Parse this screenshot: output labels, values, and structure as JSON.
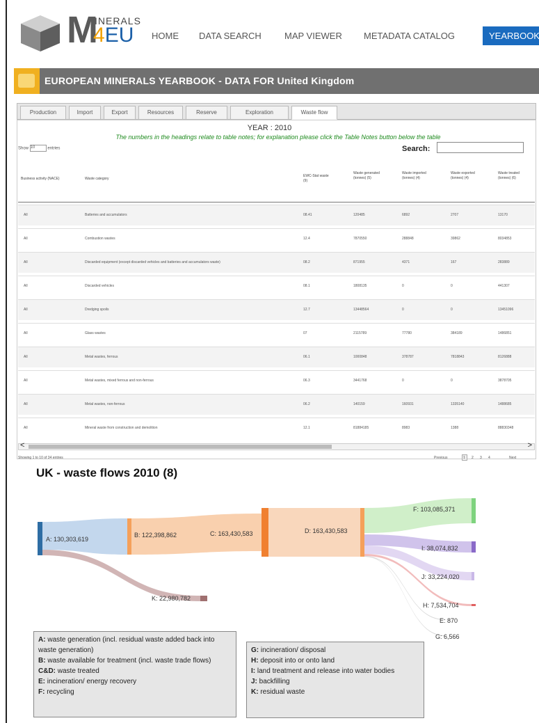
{
  "header": {
    "logo_m": "M",
    "logo_inerals": "INERALS",
    "logo_4": "4",
    "logo_eu": "EU",
    "nav": [
      "HOME",
      "DATA SEARCH",
      "MAP VIEWER",
      "METADATA CATALOG"
    ],
    "nav_active": "YEARBOOK",
    "accent": "#1a6bbf"
  },
  "titlebar": {
    "title": "EUROPEAN MINERALS YEARBOOK - DATA FOR  United Kingdom"
  },
  "tabs": [
    {
      "label": "Production"
    },
    {
      "label": "Import"
    },
    {
      "label": "Export"
    },
    {
      "label": "Resources"
    },
    {
      "label": "Reserve"
    },
    {
      "label": "Exploration"
    },
    {
      "label": "Waste flow"
    }
  ],
  "table_meta": {
    "year": "YEAR : 2010",
    "note": "The numbers in the headings relate to table notes; for explanation please click the Table Notes button below the table",
    "show_prefix": "Show",
    "show_value": "10",
    "show_suffix": "entries",
    "search_label": "Search:",
    "info": "Showing 1 to 10 of 34 entries",
    "prev": "Previous",
    "next": "Next",
    "pages": [
      "1",
      "2",
      "3",
      "4"
    ]
  },
  "table": {
    "headers": [
      "Business activity (NACE)",
      "Waste category",
      "EWC-Stat waste (9)",
      "Waste generated (tonnes) (5)",
      "Waste imported (tonnes) (4)",
      "Waste exported (tonnes) (4)",
      "Waste treated (tonnes) (6)"
    ],
    "rows": [
      [
        "All",
        "Batteries and accumulators",
        "08.41",
        "120485",
        "6892",
        "2707",
        "13170"
      ],
      [
        "All",
        "Combustion wastes",
        "12.4",
        "7870550",
        "288848",
        "39862",
        "8034853"
      ],
      [
        "All",
        "Discarded equipment (except discarded vehicles and batteries and accumulators waste)",
        "08.2",
        "871955",
        "4371",
        "167",
        "283889"
      ],
      [
        "All",
        "Discarded vehicles",
        "08.1",
        "1808135",
        "0",
        "0",
        "441307"
      ],
      [
        "All",
        "Dredging spoils",
        "12.7",
        "13448564",
        "0",
        "0",
        "13451096"
      ],
      [
        "All",
        "Glass wastes",
        "07",
        "2115789",
        "77780",
        "384189",
        "1486851"
      ],
      [
        "All",
        "Metal wastes, ferrous",
        "06.1",
        "1000848",
        "378787",
        "7818843",
        "8126888"
      ],
      [
        "All",
        "Metal wastes, mixed ferrous and non-ferrous",
        "06.3",
        "3441768",
        "0",
        "0",
        "3878705"
      ],
      [
        "All",
        "Metal wastes, non-ferrous",
        "06.2",
        "140159",
        "160931",
        "1335140",
        "1488685"
      ],
      [
        "All",
        "Mineral waste from construction and demolition",
        "12.1",
        "81884185",
        "8983",
        "1388",
        "88830348"
      ]
    ]
  },
  "chart_title": "UK - waste flows 2010 (8)",
  "chart_data": {
    "type": "sankey",
    "title": "UK - waste flows 2010 (8)",
    "nodes": [
      {
        "id": "A",
        "label": "A: 130,303,619",
        "value": 130303619,
        "color": "#2e6da4"
      },
      {
        "id": "B",
        "label": "B: 122,398,862",
        "value": 122398862,
        "color": "#f5a05a"
      },
      {
        "id": "C",
        "label": "C: 163,430,583",
        "value": 163430583,
        "color": "#f08030"
      },
      {
        "id": "D",
        "label": "D: 163,430,583",
        "value": 163430583,
        "color": "#f5a05a"
      },
      {
        "id": "F",
        "label": "F: 103,085,371",
        "value": 103085371,
        "color": "#7fd37f"
      },
      {
        "id": "I",
        "label": "I: 38,074,832",
        "value": 38074832,
        "color": "#8a6ac8"
      },
      {
        "id": "J",
        "label": "J: 33,224,020",
        "value": 33224020,
        "color": "#c9b8e8"
      },
      {
        "id": "H",
        "label": "H: 7,534,704",
        "value": 7534704,
        "color": "#e06060"
      },
      {
        "id": "E",
        "label": "E: 870",
        "value": 870,
        "color": "#999999"
      },
      {
        "id": "G",
        "label": "G: 6,566",
        "value": 6566,
        "color": "#999999"
      },
      {
        "id": "K",
        "label": "K: 22,980,782",
        "value": 22980782,
        "color": "#a07070"
      }
    ],
    "links": [
      {
        "source": "A",
        "target": "B",
        "value": 107322837,
        "color": "#b8d0ea"
      },
      {
        "source": "A",
        "target": "K",
        "value": 22980782,
        "color": "#c9a8a8"
      },
      {
        "source": "B",
        "target": "C",
        "value": 122398862,
        "color": "#f8c8a0"
      },
      {
        "source": "C",
        "target": "D",
        "value": 163430583,
        "color": "#f8d0b0"
      },
      {
        "source": "D",
        "target": "F",
        "value": 103085371,
        "color": "#c8ecc0"
      },
      {
        "source": "D",
        "target": "I",
        "value": 38074832,
        "color": "#c8b8e8"
      },
      {
        "source": "D",
        "target": "J",
        "value": 33224020,
        "color": "#ddd0f0"
      },
      {
        "source": "D",
        "target": "H",
        "value": 7534704,
        "color": "#f0b0b0"
      },
      {
        "source": "D",
        "target": "E",
        "value": 870,
        "color": "#d0d0d0"
      },
      {
        "source": "D",
        "target": "G",
        "value": 6566,
        "color": "#d0d0d0"
      }
    ]
  },
  "legend_left": [
    {
      "key": "A:",
      "text": " waste generation (incl. residual waste added back into waste generation)"
    },
    {
      "key": "B:",
      "text": " waste available for treatment (incl. waste trade flows)"
    },
    {
      "key": "C&D:",
      "text": " waste treated"
    },
    {
      "key": "E:",
      "text": " incineration/ energy recovery"
    },
    {
      "key": "F:",
      "text": " recycling"
    }
  ],
  "legend_right": [
    {
      "key": "G:",
      "text": " incineration/ disposal"
    },
    {
      "key": "H:",
      "text": " deposit into or onto land"
    },
    {
      "key": "I:",
      "text": " land treatment and release into water bodies"
    },
    {
      "key": "J:",
      "text": " backfilling"
    },
    {
      "key": "K:",
      "text": " residual waste"
    }
  ]
}
